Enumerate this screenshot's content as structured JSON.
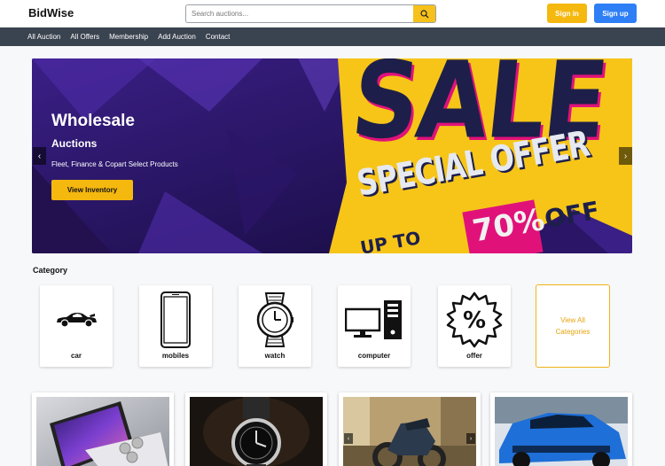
{
  "header": {
    "logo": "BidWise",
    "search_placeholder": "Search auctions...",
    "signin_label": "Sign in",
    "signup_label": "Sign up"
  },
  "nav": {
    "items": [
      "All Auction",
      "All Offers",
      "Membership",
      "Add Auction",
      "Contact"
    ]
  },
  "hero": {
    "title": "Wholesale",
    "subtitle": "Auctions",
    "description": "Fleet, Finance & Copart Select Products",
    "button_label": "View Inventory",
    "prev_glyph": "‹",
    "next_glyph": "›",
    "banner_text": {
      "sale": "SALE",
      "special_offer": "SPECIAL OFFER",
      "upto": "UP TO",
      "percent": "70%",
      "off": "OFF"
    }
  },
  "category": {
    "heading": "Category",
    "items": [
      {
        "label": "car",
        "icon": "car-icon"
      },
      {
        "label": "mobiles",
        "icon": "mobile-icon"
      },
      {
        "label": "watch",
        "icon": "watch-icon"
      },
      {
        "label": "computer",
        "icon": "computer-icon"
      },
      {
        "label": "offer",
        "icon": "offer-badge-icon"
      }
    ],
    "view_all": [
      "View All",
      "Categories"
    ]
  },
  "products": [
    {
      "image": "smartphones-image"
    },
    {
      "image": "wristwatch-image"
    },
    {
      "image": "motorcycle-image"
    },
    {
      "image": "blue-sports-car-image"
    }
  ],
  "colors": {
    "accent_yellow": "#f5b80f",
    "primary_blue": "#2e7ff6",
    "nav_bg": "#3a4350",
    "banner_pink": "#e0127a"
  }
}
